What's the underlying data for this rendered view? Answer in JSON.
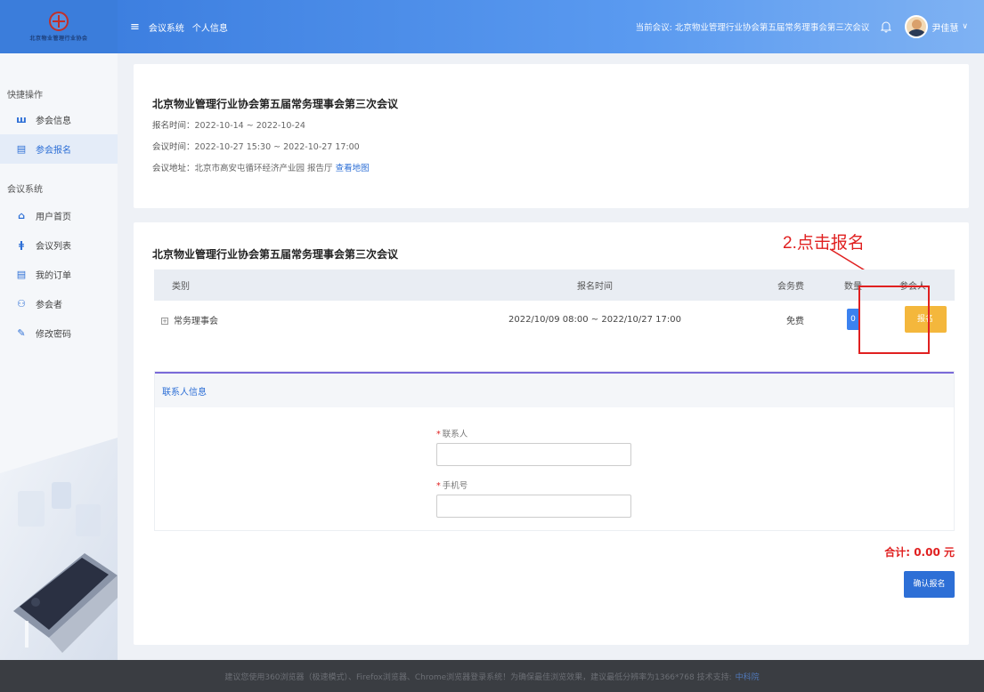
{
  "header": {
    "logo_text": "北京物业管理行业协会",
    "nav": [
      "会议系统",
      "个人信息"
    ],
    "current_meeting": "当前会议: 北京物业管理行业协会第五届常务理事会第三次会议",
    "username": "尹佳慧",
    "icons": {
      "menu": "menu-icon",
      "bell": "bell-icon",
      "chevron": "chevron-down-icon"
    }
  },
  "sidebar": {
    "section1_title": "快捷操作",
    "section1_items": [
      {
        "label": "参会信息",
        "icon": "signal-icon",
        "active": false
      },
      {
        "label": "参会报名",
        "icon": "document-icon",
        "active": true
      }
    ],
    "section2_title": "会议系统",
    "section2_items": [
      {
        "label": "用户首页",
        "icon": "home-icon"
      },
      {
        "label": "会议列表",
        "icon": "list-icon"
      },
      {
        "label": "我的订单",
        "icon": "order-icon"
      },
      {
        "label": "参会者",
        "icon": "users-icon"
      },
      {
        "label": "修改密码",
        "icon": "edit-icon"
      }
    ]
  },
  "meeting_info": {
    "title": "北京物业管理行业协会第五届常务理事会第三次会议",
    "signup_label": "报名时间：",
    "signup_value": "2022-10-14 ~ 2022-10-24",
    "meeting_label": "会议时间：",
    "meeting_value": "2022-10-27 15:30 ~ 2022-10-27 17:00",
    "address_label": "会议地址：",
    "address_value": "北京市高安屯循环经济产业园 报告厅",
    "map_link": "查看地图"
  },
  "registration": {
    "title": "北京物业管理行业协会第五届常务理事会第三次会议",
    "annotation": "2.点击报名",
    "columns": [
      "类别",
      "报名时间",
      "会务费",
      "数量",
      "参会人"
    ],
    "rows": [
      {
        "category": "常务理事会",
        "time": "2022/10/09 08:00 ~ 2022/10/27 17:00",
        "fee": "免费",
        "qty": "0",
        "action": "报名"
      }
    ],
    "expand_symbol": "+"
  },
  "contact": {
    "title": "联系人信息",
    "required_mark": "*",
    "contact_label": "联系人",
    "phone_label": "手机号",
    "contact_value": "",
    "phone_value": ""
  },
  "summary": {
    "total": "合计:  0.00 元",
    "confirm": "确认报名"
  },
  "footer": {
    "text": "建议您使用360浏览器（极速模式）、Firefox浏览器、Chrome浏览器登录系统！为确保最佳浏览效果，建议最低分辨率为1366*768  技术支持:",
    "support": "中科院"
  },
  "colors": {
    "primary": "#2d6fd6",
    "warning": "#f4b73c",
    "danger": "#e02020"
  }
}
